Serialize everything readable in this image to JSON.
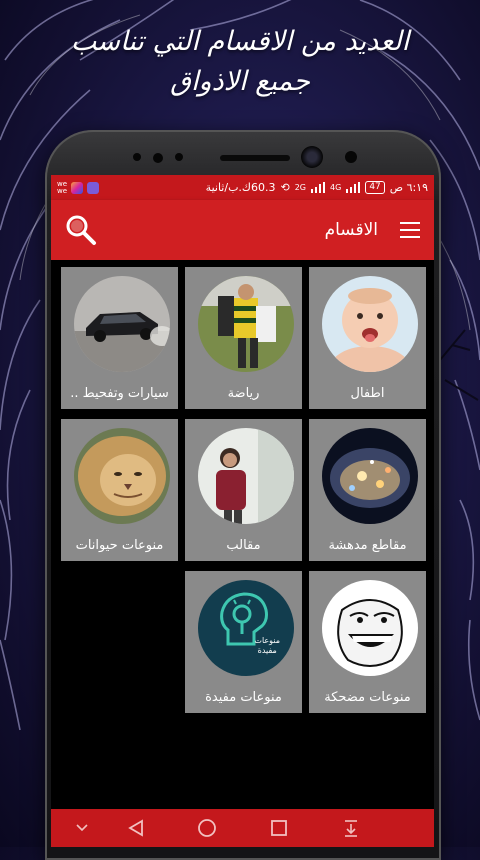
{
  "promo": {
    "line1": "العديد من الاقسام التي تناسب",
    "line2": "جميع الاذواق"
  },
  "statusbar": {
    "time": "٦:١٩ ص",
    "battery": "47",
    "signal": "4G",
    "network_type": "2G",
    "speed": "60.3ك.ب/ثانية",
    "we_label": "we"
  },
  "appbar": {
    "title": "الاقسام",
    "menu_icon": "hamburger-menu-icon",
    "search_icon": "search-icon"
  },
  "categories": [
    {
      "label": "اطفال",
      "icon": "baby-face"
    },
    {
      "label": "رياضة",
      "icon": "rugby-players"
    },
    {
      "label": "سيارات وتفحيط ..",
      "icon": "drifting-car"
    },
    {
      "label": "مقاطع مدهشة",
      "icon": "city-lights"
    },
    {
      "label": "مقالب",
      "icon": "prank-person"
    },
    {
      "label": "منوعات حيوانات",
      "icon": "lion"
    },
    {
      "label": "منوعات مضحكة",
      "icon": "troll-face"
    },
    {
      "label": "منوعات مفيدة",
      "icon": "lightbulb-head"
    }
  ],
  "useful_icon_text": {
    "line1": "منوعات",
    "line2": "مفيدة"
  },
  "colors": {
    "accent": "#d01f22",
    "statusbar": "#c4181c",
    "card": "#8a8a8a"
  }
}
